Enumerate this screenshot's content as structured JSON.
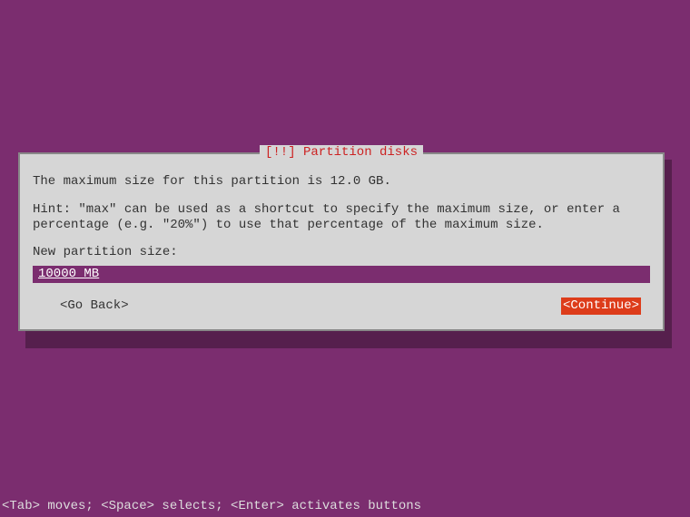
{
  "dialog": {
    "title": "[!!] Partition disks",
    "max_size_text": "The maximum size for this partition is 12.0 GB.",
    "hint_text": "Hint: \"max\" can be used as a shortcut to specify the maximum size, or enter a percentage (e.g. \"20%\") to use that percentage of the maximum size.",
    "label": "New partition size:",
    "input_value": "10000 MB",
    "go_back_label": "<Go Back>",
    "continue_label": "<Continue>"
  },
  "footer": {
    "help_text": "<Tab> moves; <Space> selects; <Enter> activates buttons"
  }
}
